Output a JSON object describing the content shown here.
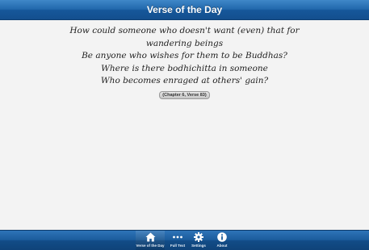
{
  "header": {
    "title": "Verse of the Day"
  },
  "verse": {
    "lines": [
      "How could someone who doesn't want (even) that for",
      "wandering beings",
      "Be anyone who wishes for them to be Buddhas?",
      "Where is there bodhichitta in someone",
      "Who becomes enraged at others' gain?"
    ],
    "reference": "(Chapter 6, Verse 83)"
  },
  "tab_bar": {
    "tabs": [
      {
        "label": "Verse of the Day",
        "icon": "home-icon",
        "active": true
      },
      {
        "label": "Full Text",
        "icon": "more-icon",
        "active": false
      },
      {
        "label": "Settings",
        "icon": "gear-icon",
        "active": false
      },
      {
        "label": "About",
        "icon": "info-icon",
        "active": false
      }
    ]
  },
  "colors": {
    "header_blue": "#1b5fa3",
    "background": "#f3f3f3"
  }
}
